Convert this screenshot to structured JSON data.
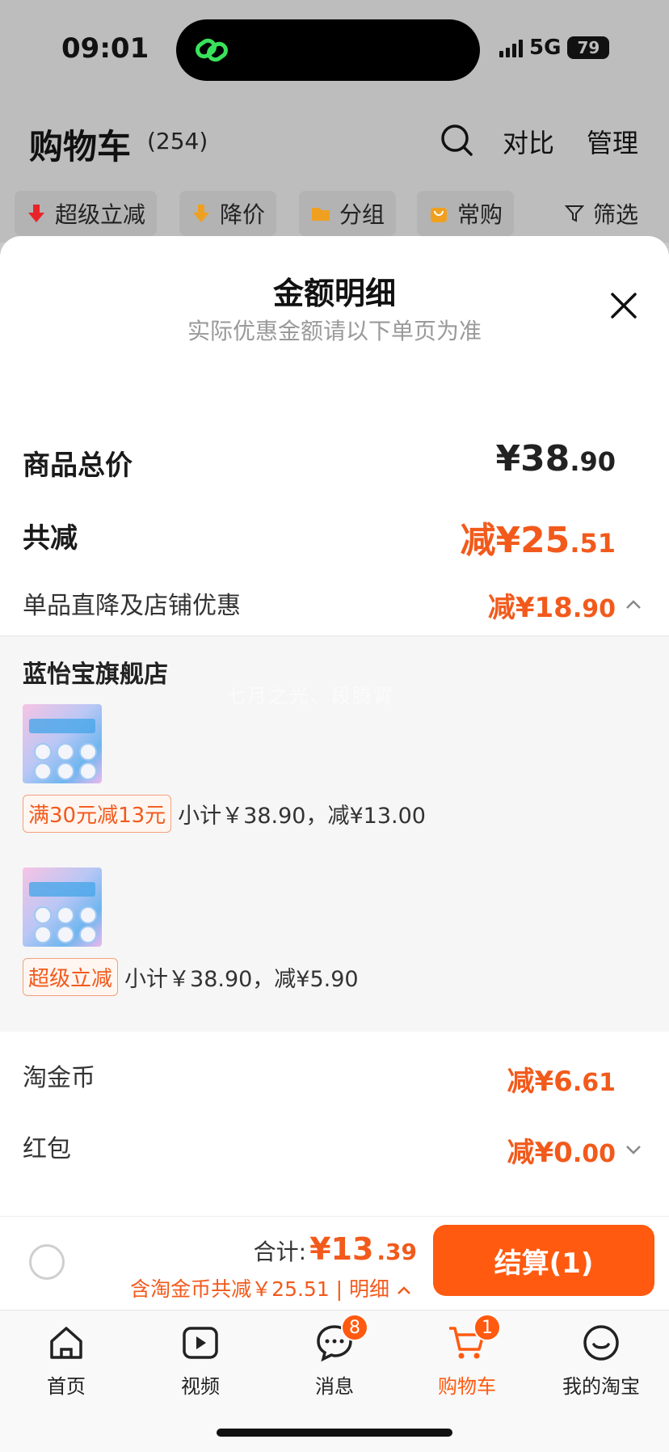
{
  "status": {
    "time": "09:01",
    "network": "5G",
    "battery": "79"
  },
  "cart": {
    "title": "购物车",
    "count": "(254)",
    "compare": "对比",
    "manage": "管理",
    "filters": [
      "超级立减",
      "降价",
      "分组",
      "常购",
      "筛选"
    ]
  },
  "sheet": {
    "title": "金额明细",
    "subtitle": "实际优惠金额请以下单页为准",
    "total_label": "商品总价",
    "total_big": "¥38",
    "total_small": ".90",
    "discount_label": "共减",
    "discount_big": "减¥25",
    "discount_small": ".51",
    "store_discount_label": "单品直降及店铺优惠",
    "store_discount_big": "减¥18",
    "store_discount_small": ".90",
    "store": {
      "name": "蓝怡宝旗舰店",
      "watermark": "七月之光、段腾霄",
      "items": [
        {
          "tag": "满30元减13元",
          "text": "小计￥38.90，减¥13.00"
        },
        {
          "tag": "超级立减",
          "text": "小计￥38.90，减¥5.90"
        }
      ]
    },
    "coins_label": "淘金币",
    "coins_big": "减¥6",
    "coins_small": ".61",
    "redpacket_label": "红包",
    "redpacket_big": "减¥0",
    "redpacket_small": ".00"
  },
  "checkout": {
    "total_label": "合计:",
    "total_big": "¥13",
    "total_small": ".39",
    "discount_text": "含淘金币共减￥25.51 | 明细",
    "button": "结算(1)"
  },
  "tabs": [
    {
      "label": "首页",
      "icon": "home-icon"
    },
    {
      "label": "视频",
      "icon": "video-icon"
    },
    {
      "label": "消息",
      "icon": "message-icon",
      "badge": "8"
    },
    {
      "label": "购物车",
      "icon": "cart-icon",
      "badge": "1"
    },
    {
      "label": "我的淘宝",
      "icon": "profile-icon"
    }
  ],
  "colors": {
    "accent": "#ff5a10",
    "price_red": "#f25a1c"
  }
}
